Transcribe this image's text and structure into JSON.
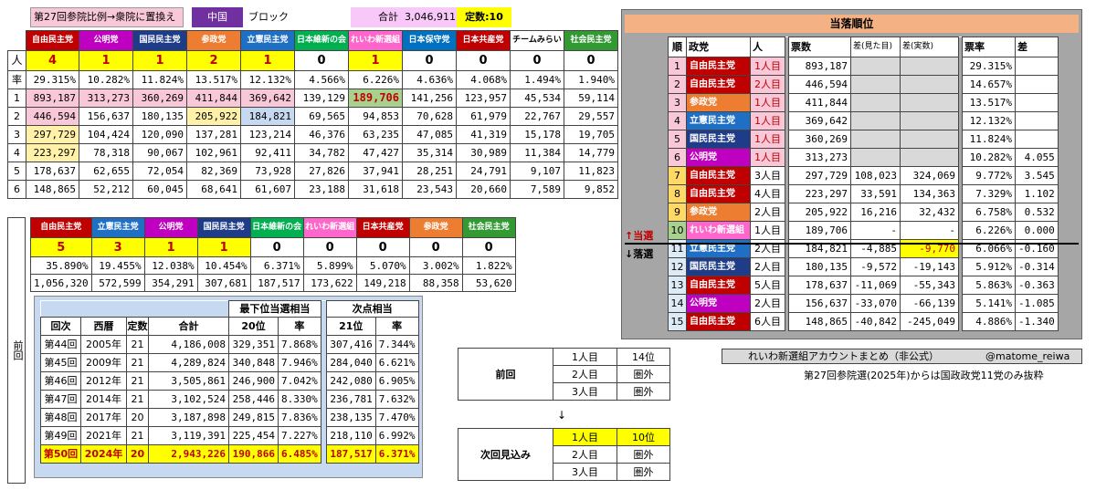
{
  "header": {
    "title": "第27回参院比例→衆院に置換え",
    "region": "中国",
    "block": "ブロック",
    "total_label": "合計",
    "total_value": "3,046,911",
    "seats_label": "定数:10"
  },
  "colors": {
    "jimin": "#c00000",
    "komei": "#c000c0",
    "kokumin": "#1f3c88",
    "sansei": "#ed7d31",
    "rikken": "#1f6fc5",
    "ishin": "#00b050",
    "reiwa": "#ff66cc",
    "hoshu": "#0070c0",
    "kyosan": "#c00000",
    "teammirai": "#ffffff",
    "shamin": "#339933"
  },
  "main": {
    "row_labels": [
      "人",
      "率",
      "1",
      "2",
      "3",
      "4",
      "5",
      "6"
    ],
    "parties": [
      {
        "name": "自由民主党",
        "c": "#c00000",
        "seats": "4",
        "rate": "29.315%",
        "v": [
          "893,187",
          "446,594",
          "297,729",
          "223,297",
          "178,637",
          "148,865"
        ],
        "hl": [
          "pink",
          "pink",
          "ltyel",
          "ltyel",
          "",
          ""
        ]
      },
      {
        "name": "公明党",
        "c": "#c000c0",
        "seats": "1",
        "rate": "10.282%",
        "v": [
          "313,273",
          "156,637",
          "104,424",
          "78,318",
          "62,655",
          "52,212"
        ],
        "hl": [
          "pink",
          "",
          "",
          "",
          "",
          ""
        ]
      },
      {
        "name": "国民民主党",
        "c": "#1f3c88",
        "seats": "1",
        "rate": "11.824%",
        "v": [
          "360,269",
          "180,135",
          "120,090",
          "90,067",
          "72,054",
          "60,045"
        ],
        "hl": [
          "pink",
          "",
          "",
          "",
          "",
          ""
        ]
      },
      {
        "name": "参政党",
        "c": "#ed7d31",
        "seats": "2",
        "rate": "13.517%",
        "v": [
          "411,844",
          "205,922",
          "137,281",
          "102,961",
          "82,369",
          "68,641"
        ],
        "hl": [
          "pink",
          "ltyel",
          "",
          "",
          "",
          ""
        ]
      },
      {
        "name": "立憲民主党",
        "c": "#1f6fc5",
        "seats": "1",
        "rate": "12.132%",
        "v": [
          "369,642",
          "184,821",
          "123,214",
          "92,411",
          "73,928",
          "61,607"
        ],
        "hl": [
          "pink",
          "ltblue",
          "",
          "",
          "",
          ""
        ]
      },
      {
        "name": "日本維新の会",
        "c": "#00b050",
        "seats": "0",
        "rate": "4.566%",
        "v": [
          "139,129",
          "69,565",
          "46,376",
          "34,782",
          "27,826",
          "23,188"
        ],
        "hl": [
          "",
          "",
          "",
          "",
          "",
          ""
        ]
      },
      {
        "name": "れいわ新選組",
        "c": "#ff66cc",
        "seats": "1",
        "rate": "6.226%",
        "v": [
          "189,706",
          "94,853",
          "63,235",
          "47,427",
          "37,941",
          "31,618"
        ],
        "hl": [
          "green",
          "",
          "",
          "",
          "",
          ""
        ]
      },
      {
        "name": "日本保守党",
        "c": "#0070c0",
        "seats": "0",
        "rate": "4.636%",
        "v": [
          "141,256",
          "70,628",
          "47,085",
          "35,314",
          "28,251",
          "23,543"
        ],
        "hl": [
          "",
          "",
          "",
          "",
          "",
          ""
        ]
      },
      {
        "name": "日本共産党",
        "c": "#c00000",
        "seats": "0",
        "rate": "4.068%",
        "v": [
          "123,957",
          "61,979",
          "41,319",
          "30,989",
          "24,791",
          "20,660"
        ],
        "hl": [
          "",
          "",
          "",
          "",
          "",
          ""
        ]
      },
      {
        "name": "チームみらい",
        "c": "#ffffff",
        "seats": "0",
        "rate": "1.494%",
        "v": [
          "45,534",
          "22,767",
          "15,178",
          "11,384",
          "9,107",
          "7,589"
        ],
        "hl": [
          "",
          "",
          "",
          "",
          "",
          ""
        ]
      },
      {
        "name": "社会民主党",
        "c": "#339933",
        "seats": "0",
        "rate": "1.940%",
        "v": [
          "59,114",
          "29,557",
          "19,705",
          "14,779",
          "11,823",
          "9,852"
        ],
        "hl": [
          "",
          "",
          "",
          "",
          "",
          ""
        ]
      }
    ]
  },
  "prev": {
    "label": "前回",
    "parties": [
      {
        "name": "自由民主党",
        "c": "#c00000",
        "seats": "5",
        "rate": "35.890%",
        "votes": "1,056,320"
      },
      {
        "name": "立憲民主党",
        "c": "#1f6fc5",
        "seats": "3",
        "rate": "19.455%",
        "votes": "572,599"
      },
      {
        "name": "公明党",
        "c": "#c000c0",
        "seats": "1",
        "rate": "12.038%",
        "votes": "354,291"
      },
      {
        "name": "国民民主党",
        "c": "#1f3c88",
        "seats": "1",
        "rate": "10.454%",
        "votes": "307,681"
      },
      {
        "name": "日本維新の会",
        "c": "#00b050",
        "seats": "0",
        "rate": "6.371%",
        "votes": "187,517"
      },
      {
        "name": "れいわ新選組",
        "c": "#ff66cc",
        "seats": "0",
        "rate": "5.899%",
        "votes": "173,622"
      },
      {
        "name": "日本共産党",
        "c": "#c00000",
        "seats": "0",
        "rate": "5.070%",
        "votes": "149,218"
      },
      {
        "name": "参政党",
        "c": "#ed7d31",
        "seats": "0",
        "rate": "3.002%",
        "votes": "88,358"
      },
      {
        "name": "社会民主党",
        "c": "#339933",
        "seats": "0",
        "rate": "1.822%",
        "votes": "53,620"
      }
    ]
  },
  "history": {
    "group1": "最下位当選相当",
    "group2": "次点相当",
    "headers": [
      "回次",
      "西暦",
      "定数",
      "合計",
      "20位",
      "率",
      "21位",
      "率"
    ],
    "rows": [
      [
        "第44回",
        "2005年",
        "21",
        "4,186,008",
        "329,351",
        "7.868%",
        "307,416",
        "7.344%"
      ],
      [
        "第45回",
        "2009年",
        "21",
        "4,289,824",
        "340,848",
        "7.946%",
        "284,040",
        "6.621%"
      ],
      [
        "第46回",
        "2012年",
        "21",
        "3,505,861",
        "246,900",
        "7.042%",
        "242,080",
        "6.905%"
      ],
      [
        "第47回",
        "2014年",
        "21",
        "3,102,524",
        "258,446",
        "8.330%",
        "236,781",
        "7.632%"
      ],
      [
        "第48回",
        "2017年",
        "20",
        "3,187,898",
        "249,815",
        "7.836%",
        "238,135",
        "7.470%"
      ],
      [
        "第49回",
        "2021年",
        "21",
        "3,119,391",
        "225,454",
        "7.227%",
        "218,110",
        "6.992%"
      ],
      [
        "第50回",
        "2024年",
        "20",
        "2,943,226",
        "190,866",
        "6.485%",
        "187,517",
        "6.371%"
      ]
    ]
  },
  "reiwa_box": {
    "prev_label": "前回",
    "next_label": "次回見込み",
    "arrow": "↓",
    "prev_rows": [
      [
        "1人目",
        "14位"
      ],
      [
        "2人目",
        "圏外"
      ],
      [
        "3人目",
        "圏外"
      ]
    ],
    "next_rows": [
      [
        "1人目",
        "10位"
      ],
      [
        "2人目",
        "圏外"
      ],
      [
        "3人目",
        "圏外"
      ]
    ]
  },
  "ranking": {
    "title": "当落順位",
    "headers": [
      "順",
      "政党",
      "人",
      "票数",
      "差(見た目)",
      "差(実数)",
      "票率",
      "差"
    ],
    "win_label": "↑当選",
    "lose_label": "↓落選",
    "rows": [
      [
        "1",
        "自由民主党",
        "1人目",
        "893,187",
        "",
        "",
        "29.315%",
        ""
      ],
      [
        "2",
        "自由民主党",
        "2人目",
        "446,594",
        "",
        "",
        "14.657%",
        ""
      ],
      [
        "3",
        "参政党",
        "1人目",
        "411,844",
        "",
        "",
        "13.517%",
        ""
      ],
      [
        "4",
        "立憲民主党",
        "1人目",
        "369,642",
        "",
        "",
        "12.132%",
        ""
      ],
      [
        "5",
        "国民民主党",
        "1人目",
        "360,269",
        "",
        "",
        "11.824%",
        ""
      ],
      [
        "6",
        "公明党",
        "1人目",
        "313,273",
        "",
        "",
        "10.282%",
        "4.055"
      ],
      [
        "7",
        "自由民主党",
        "3人目",
        "297,729",
        "108,023",
        "324,069",
        "9.772%",
        "3.545"
      ],
      [
        "8",
        "自由民主党",
        "4人目",
        "223,297",
        "33,591",
        "134,363",
        "7.329%",
        "1.102"
      ],
      [
        "9",
        "参政党",
        "2人目",
        "205,922",
        "16,216",
        "32,432",
        "6.758%",
        "0.532"
      ],
      [
        "10",
        "れいわ新選組",
        "1人目",
        "189,706",
        "-",
        "-",
        "6.226%",
        "0.000"
      ],
      [
        "11",
        "立憲民主党",
        "2人目",
        "184,821",
        "-4,885",
        "-9,770",
        "6.066%",
        "-0.160"
      ],
      [
        "12",
        "国民民主党",
        "2人目",
        "180,135",
        "-9,572",
        "-19,143",
        "5.912%",
        "-0.314"
      ],
      [
        "13",
        "自由民主党",
        "5人目",
        "178,637",
        "-11,069",
        "-55,343",
        "5.863%",
        "-0.363"
      ],
      [
        "14",
        "公明党",
        "2人目",
        "156,637",
        "-33,070",
        "-66,139",
        "5.141%",
        "-1.085"
      ],
      [
        "15",
        "自由民主党",
        "6人目",
        "148,865",
        "-40,842",
        "-245,049",
        "4.886%",
        "-1.340"
      ]
    ]
  },
  "footer": {
    "account": "れいわ新選組アカウントまとめ（非公式）",
    "handle": "@matome_reiwa",
    "note": "第27回参院選(2025年)からは国政政党11党のみ抜粋"
  }
}
